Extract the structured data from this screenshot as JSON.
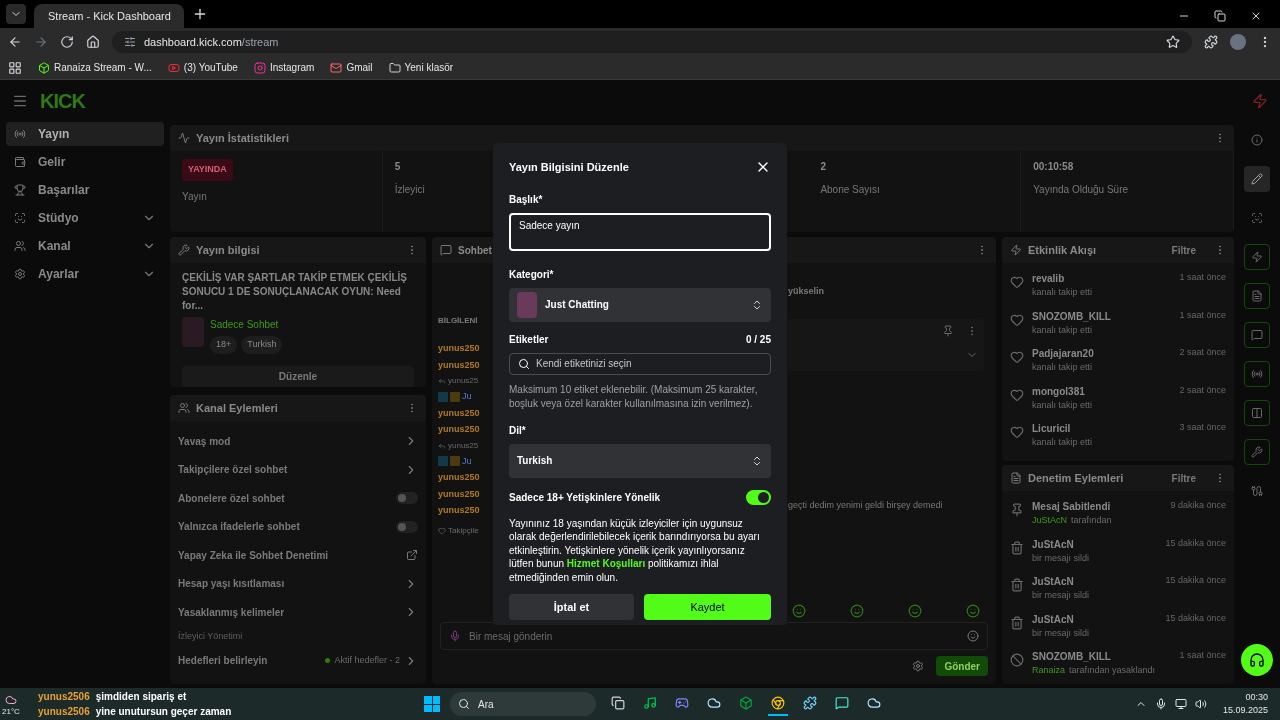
{
  "browser": {
    "tab_title": "Stream - Kick Dashboard",
    "url_host": "dashboard.kick.com",
    "url_path": "/stream",
    "bookmarks": [
      {
        "kind": "kick",
        "label": "Ranaiza Stream - W..."
      },
      {
        "kind": "youtube",
        "label": "(3) YouTube"
      },
      {
        "kind": "instagram",
        "label": "Instagram"
      },
      {
        "kind": "gmail",
        "label": "Gmail"
      },
      {
        "kind": "folder",
        "label": "Yeni klasör"
      }
    ]
  },
  "header": {
    "logo": "KICK"
  },
  "sidebar": {
    "items": [
      {
        "label": "Yayın",
        "selected": true,
        "kind": "link"
      },
      {
        "label": "Gelir",
        "selected": false,
        "kind": "link"
      },
      {
        "label": "Başarılar",
        "selected": false,
        "kind": "link"
      },
      {
        "label": "Stüdyo",
        "selected": false,
        "kind": "group"
      },
      {
        "label": "Kanal",
        "selected": false,
        "kind": "group"
      },
      {
        "label": "Ayarlar",
        "selected": false,
        "kind": "group"
      }
    ]
  },
  "stats": {
    "title": "Yayın İstatistikleri",
    "items": [
      {
        "badge": "YAYINDA",
        "label": "Yayın"
      },
      {
        "value": "5",
        "label": "İzleyici"
      },
      {
        "value": "2",
        "label": "Abone Sayısı"
      },
      {
        "value": "00:10:58",
        "label": "Yayında Olduğu Süre"
      }
    ]
  },
  "stream_info": {
    "title": "Yayın bilgisi",
    "stream_title": "ÇEKİLİŞ VAR ŞARTLAR TAKİP ETMEK ÇEKİLİŞ SONUCU 1 DE SONUÇLANACAK OYUN: Need for...",
    "category": "Sadece Sohbet",
    "tags": [
      "18+",
      "Turkish"
    ],
    "button": "Düzenle"
  },
  "channel_actions": {
    "title": "Kanal Eylemleri",
    "rows": [
      {
        "kind": "link",
        "label": "Yavaş mod"
      },
      {
        "kind": "link",
        "label": "Takipçilere özel sohbet"
      },
      {
        "kind": "toggle",
        "label": "Abonelere özel sohbet",
        "on": false
      },
      {
        "kind": "toggle",
        "label": "Yalnızca ifadelerle sohbet",
        "on": false
      },
      {
        "kind": "external",
        "label": "Yapay Zeka ile Sohbet Denetimi"
      },
      {
        "kind": "link",
        "label": "Hesap yaşı kısıtlaması"
      },
      {
        "kind": "link",
        "label": "Yasaklanmış kelimeler"
      },
      {
        "kind": "section",
        "label": "İzleyici Yönetimi"
      },
      {
        "kind": "goal",
        "label": "Hedefleri belirleyin",
        "note": "Aktif hedefler - 2"
      }
    ]
  },
  "chat": {
    "title": "Sohbet",
    "left_lines": [
      {
        "kind": "pinned",
        "text": "BİLGİLENİ"
      },
      {
        "kind": "user",
        "text": "yunus250"
      },
      {
        "kind": "user",
        "text": "yunus250"
      },
      {
        "kind": "reply",
        "text": "yunus25"
      },
      {
        "kind": "badges",
        "text": "Ju"
      },
      {
        "kind": "user",
        "text": "yunus250"
      },
      {
        "kind": "user",
        "text": "yunus250"
      },
      {
        "kind": "reply",
        "text": "yunus25"
      },
      {
        "kind": "badges",
        "text": "Ju"
      },
      {
        "kind": "user",
        "text": "yunus250"
      },
      {
        "kind": "user",
        "text": "yunus250"
      },
      {
        "kind": "user",
        "text": "yunus250"
      },
      {
        "kind": "follow",
        "text": "Takipçile"
      }
    ],
    "right_top": "yükselin",
    "right_message": "geçti dedim yenimi geldi birşey demedi",
    "input_placeholder": "Bir mesaj gönderin",
    "send": "Gönder"
  },
  "activity": {
    "title": "Etkinlik Akışı",
    "filter": "Filtre",
    "rows": [
      {
        "name": "revalib",
        "text": "kanalı takip etti",
        "time": "1 saat önce"
      },
      {
        "name": "SNOZOMB_KILL",
        "text": "kanalı takip etti",
        "time": "1 saat önce"
      },
      {
        "name": "Padjajaran20",
        "text": "kanalı takip etti",
        "time": "2 saat önce"
      },
      {
        "name": "mongol381",
        "text": "kanalı takip etti",
        "time": "2 saat önce"
      },
      {
        "name": "Licuricil",
        "text": "kanalı takip etti",
        "time": "3 saat önce"
      }
    ]
  },
  "moderation": {
    "title": "Denetim Eylemleri",
    "filter": "Filtre",
    "rows": [
      {
        "kind": "pin",
        "name": "Mesaj Sabitlendi",
        "user": "JuStAcN",
        "text": "tarafından",
        "time": "9 dakika önce"
      },
      {
        "kind": "delete",
        "name": "JuStAcN",
        "text": "bir mesajı sildi",
        "time": "15 dakika önce"
      },
      {
        "kind": "delete",
        "name": "JuStAcN",
        "text": "bir mesajı sildi",
        "time": "15 dakika önce"
      },
      {
        "kind": "delete",
        "name": "JuStAcN",
        "text": "bir mesajı sildi",
        "time": "15 dakika önce"
      },
      {
        "kind": "ban",
        "name": "SNOZOMB_KILL",
        "user": "Ranaiza",
        "text": "tarafından yasaklandı",
        "time": "1 saat önce"
      }
    ]
  },
  "rail": [
    {
      "selected": false
    },
    {
      "selected": true
    },
    {
      "selected": false
    },
    {
      "selected": false
    },
    {
      "selected": false
    },
    {
      "selected": false
    },
    {
      "selected": false
    },
    {
      "selected": false
    },
    {
      "selected": false
    },
    {
      "selected": false
    }
  ],
  "modal": {
    "title": "Yayın Bilgisini Düzenle",
    "title_label": "Başlık*",
    "title_value": "Sadece yayın",
    "category_label": "Kategori*",
    "category_value": "Just Chatting",
    "tags_label": "Etiketler",
    "tags_count": "0 / 25",
    "tags_placeholder": "Kendi etiketinizi seçin",
    "tags_help": "Maksimum 10 etiket eklenebilir. (Maksimum 25 karakter, boşluk veya özel karakter kullanılmasına izin verilmez).",
    "language_label": "Dil*",
    "language_value": "Turkish",
    "adult_label": "Sadece 18+ Yetişkinlere Yönelik",
    "adult_on": true,
    "adult_text_before": "Yayınınız 18 yaşından küçük izleyiciler için uygunsuz olarak değerlendirilebilecek içerik barındırıyorsa bu ayarı etkinleştirin. Yetişkinlere yönelik içerik yayınlıyorsanız lütfen bunun",
    "adult_link": "Hizmet Koşulları",
    "adult_text_after": "politikamızı ihlal etmediğinden emin olun.",
    "cancel": "İptal et",
    "save": "Kaydet"
  },
  "overlay_chat": [
    {
      "user": "yunus2506",
      "text": "şimdiden sipariş et"
    },
    {
      "user": "yunus2506",
      "text": "yine unutursun geçer zaman"
    }
  ],
  "taskbar": {
    "weather": "21°C",
    "search": "Ara",
    "apps": [
      {
        "selected": false
      },
      {
        "selected": false
      },
      {
        "selected": false
      },
      {
        "selected": false
      },
      {
        "selected": false
      },
      {
        "selected": true
      },
      {
        "selected": false
      },
      {
        "selected": false
      },
      {
        "selected": false
      }
    ],
    "time": "00:30",
    "date": "15.09.2025"
  }
}
